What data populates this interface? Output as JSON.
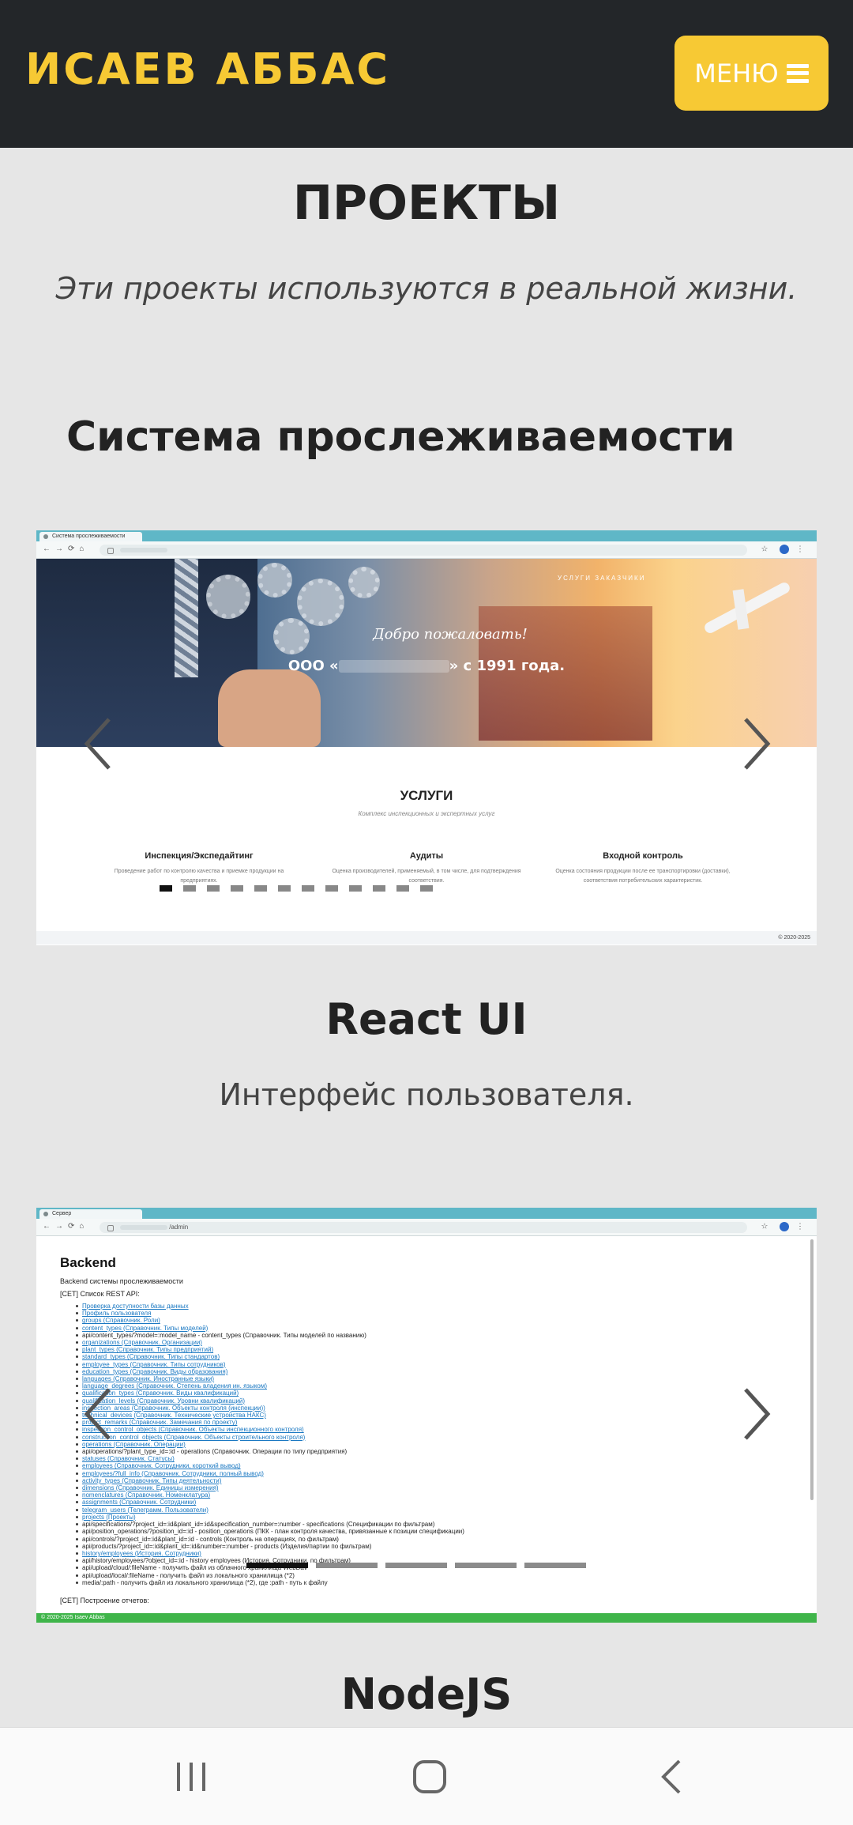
{
  "header": {
    "brand": "ИСАЕВ АББАС",
    "menu_label": "МЕНЮ"
  },
  "page": {
    "title": "ПРОЕКТЫ",
    "subtitle": "Эти проекты используются в реальной жизни."
  },
  "projects": [
    {
      "title": "Система прослеживаемости",
      "screenshot": {
        "tab_title": "Система прослеживаемости",
        "hero_welcome": "Добро пожаловать!",
        "hero_since_prefix": "ООО «",
        "hero_since_suffix": "» с 1991 года.",
        "nav_links": "УСЛУГИ    ЗАКАЗЧИКИ",
        "services_title": "УСЛУГИ",
        "services_sub": "Комплекс инспекционных и экспертных услуг",
        "services": [
          {
            "name": "Инспекция/Экспедайтинг",
            "desc": "Проведение работ по контролю качества и приемке продукции на предприятиях."
          },
          {
            "name": "Аудиты",
            "desc": "Оценка производителей, применяемый, в том числе, для подтверждения соответствия."
          },
          {
            "name": "Входной контроль",
            "desc": "Оценка состояния продукции после ее транспортировки (доставки), соответствия потребительских характеристик."
          }
        ],
        "footer": "© 2020-2025"
      },
      "carousel": {
        "slides": 12,
        "active": 0
      }
    },
    {
      "title": "React UI",
      "subtitle": "Интерфейс пользователя.",
      "screenshot": {
        "tab_title": "Сервер",
        "url_path": "/admin",
        "heading": "Backend",
        "subheading": "Backend системы прослеживаемости",
        "section": "[CET] Список REST API:",
        "api_items": [
          {
            "text": "Проверка доступности базы данных",
            "link": true
          },
          {
            "text": "Профиль пользователя",
            "link": true
          },
          {
            "text": "groups (Справочник. Роли)",
            "link": true
          },
          {
            "text": "content_types (Справочник. Типы моделей)",
            "link": true
          },
          {
            "text": "api/content_types/?model=:model_name - content_types (Справочник. Типы моделей по названию)",
            "link": false
          },
          {
            "text": "organizations (Справочник. Организации)",
            "link": true
          },
          {
            "text": "plant_types (Справочник. Типы предприятий)",
            "link": true
          },
          {
            "text": "standard_types (Справочник. Типы стандартов)",
            "link": true
          },
          {
            "text": "employee_types (Справочник. Типы сотрудников)",
            "link": true
          },
          {
            "text": "education_types (Справочник. Виды образования)",
            "link": true
          },
          {
            "text": "languages (Справочник. Иностранные языки)",
            "link": true
          },
          {
            "text": "language_degrees (Справочник. Степень владения ин. языком)",
            "link": true
          },
          {
            "text": "qualification_types (Справочник. Виды квалификаций)",
            "link": true
          },
          {
            "text": "qualification_levels (Справочник. Уровни квалификаций)",
            "link": true
          },
          {
            "text": "inspection_areas (Справочник. Объекты контроля (инспекции))",
            "link": true
          },
          {
            "text": "technical_devices (Справочник. Технические устройства НАКС)",
            "link": true
          },
          {
            "text": "project_remarks (Справочник. Замечания по проекту)",
            "link": true
          },
          {
            "text": "inspection_control_objects (Справочник. Объекты инспекционного контроля)",
            "link": true
          },
          {
            "text": "construction_control_objects (Справочник. Объекты строительного контроля)",
            "link": true
          },
          {
            "text": "operations (Справочник. Операции)",
            "link": true
          },
          {
            "text": "api/operations/?plant_type_id=:id - operations (Справочник. Операции по типу предприятия)",
            "link": false
          },
          {
            "text": "statuses (Справочник. Статусы)",
            "link": true
          },
          {
            "text": "employees (Справочник. Сотрудники, короткий вывод)",
            "link": true
          },
          {
            "text": "employees/?full_info (Справочник. Сотрудники, полный вывод)",
            "link": true
          },
          {
            "text": "activity_types (Справочник. Типы деятельности)",
            "link": true
          },
          {
            "text": "dimensions (Справочник. Единицы измерения)",
            "link": true
          },
          {
            "text": "nomenclatures (Справочник. Номенклатура)",
            "link": true
          },
          {
            "text": "assignments (Справочник. Сотрудники)",
            "link": true
          },
          {
            "text": "telegram_users (Телеграмм. Пользователи)",
            "link": true
          },
          {
            "text": "projects (Проекты)",
            "link": true
          },
          {
            "text": "api/specifications/?project_id=:id&plant_id=:id&specification_number=:number - specifications (Спецификации по фильтрам)",
            "link": false
          },
          {
            "text": "api/position_operations/?position_id=:id - position_operations (ПКК - план контроля качества, привязанные к позиции спецификации)",
            "link": false
          },
          {
            "text": "api/controls/?project_id=:id&plant_id=:id - controls (Контроль на операциях, по фильтрам)",
            "link": false
          },
          {
            "text": "api/products/?project_id=:id&plant_id=:id&number=:number - products (Изделия/партии по фильтрам)",
            "link": false
          },
          {
            "text": "history/employees (История. Сотрудники)",
            "link": true
          },
          {
            "text": "api/history/employees/?object_id=:id - history employees (История. Сотрудники, по фильтрам)",
            "link": false
          },
          {
            "text": "api/upload/cloud/:fileName - получить файл из облачного хранилища WebDav",
            "link": false
          },
          {
            "text": "api/upload/local/:fileName - получить файл из локального хранилища (*2)",
            "link": false
          },
          {
            "text": "media/:path - получить файл из локального хранилища (*2), где :path - путь к файлу",
            "link": false
          }
        ],
        "section2": "[CET] Построение отчетов:",
        "footer": "© 2020-2025 Isaev Abbas"
      },
      "carousel": {
        "slides": 5,
        "active": 0
      }
    },
    {
      "title": "NodeJS"
    }
  ],
  "colors": {
    "accent": "#f7c934",
    "header_bg": "#232629",
    "page_bg": "#e6e6e6"
  },
  "system_nav": {
    "recents": "recents-icon",
    "home": "home-icon",
    "back": "back-icon"
  }
}
